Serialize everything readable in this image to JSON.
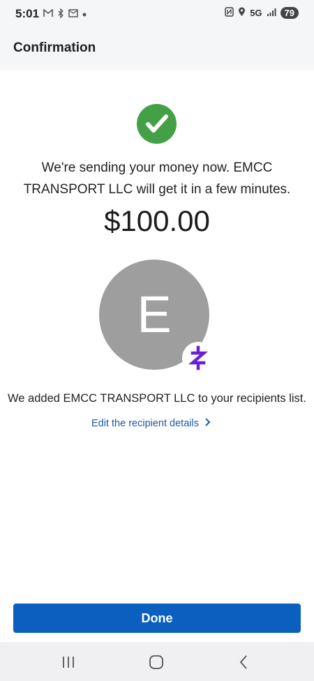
{
  "status": {
    "time": "5:01",
    "network": "5G",
    "battery": "79"
  },
  "header": {
    "title": "Confirmation"
  },
  "confirmation": {
    "message_line1": "We're sending your money now. EMCC",
    "message_line2": "TRANSPORT LLC will get it in a few minutes.",
    "amount": "$100.00",
    "avatar_letter": "E",
    "added_text": "We added EMCC TRANSPORT LLC to your recipients list.",
    "edit_link": "Edit the recipient details"
  },
  "actions": {
    "done_label": "Done"
  },
  "colors": {
    "check_green": "#43a047",
    "link_blue": "#1a5aa6",
    "button_blue": "#0b5fbf",
    "zelle_purple": "#6d1ed4",
    "avatar_gray": "#9e9e9e"
  },
  "icons": {
    "status_left": [
      "gmail-icon",
      "bluetooth-icon",
      "mail-icon",
      "dot-icon"
    ],
    "status_right": [
      "nfc-icon",
      "location-icon",
      "signal-icon"
    ],
    "nav": [
      "recent-apps-icon",
      "home-icon",
      "back-icon"
    ]
  }
}
